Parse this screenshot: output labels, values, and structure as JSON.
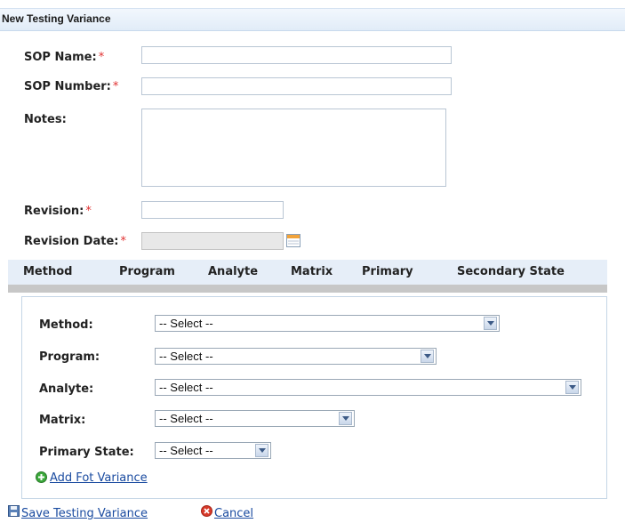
{
  "title": "New Testing Variance",
  "form": {
    "sop_name": {
      "label": "SOP Name:",
      "required": "*",
      "value": ""
    },
    "sop_number": {
      "label": "SOP Number:",
      "required": "*",
      "value": ""
    },
    "notes": {
      "label": "Notes:",
      "value": ""
    },
    "revision": {
      "label": "Revision:",
      "required": "*",
      "value": ""
    },
    "revision_date": {
      "label": "Revision Date:",
      "required": "*",
      "value": ""
    }
  },
  "grid": {
    "columns": [
      "Method",
      "Program",
      "Analyte",
      "Matrix",
      "Primary",
      "Secondary State"
    ]
  },
  "variance": {
    "method": {
      "label": "Method:",
      "value": "-- Select --"
    },
    "program": {
      "label": "Program:",
      "value": "-- Select --"
    },
    "analyte": {
      "label": "Analyte:",
      "value": "-- Select --"
    },
    "matrix": {
      "label": "Matrix:",
      "value": "-- Select --"
    },
    "primary_state": {
      "label": "Primary State:",
      "value": "-- Select --"
    },
    "add_link": "Add Fot Variance"
  },
  "actions": {
    "save": "Save Testing Variance",
    "cancel": "Cancel"
  },
  "colors": {
    "accent": "#1a4ba0",
    "required": "#e03030",
    "header_bg": "#e6eef8"
  }
}
